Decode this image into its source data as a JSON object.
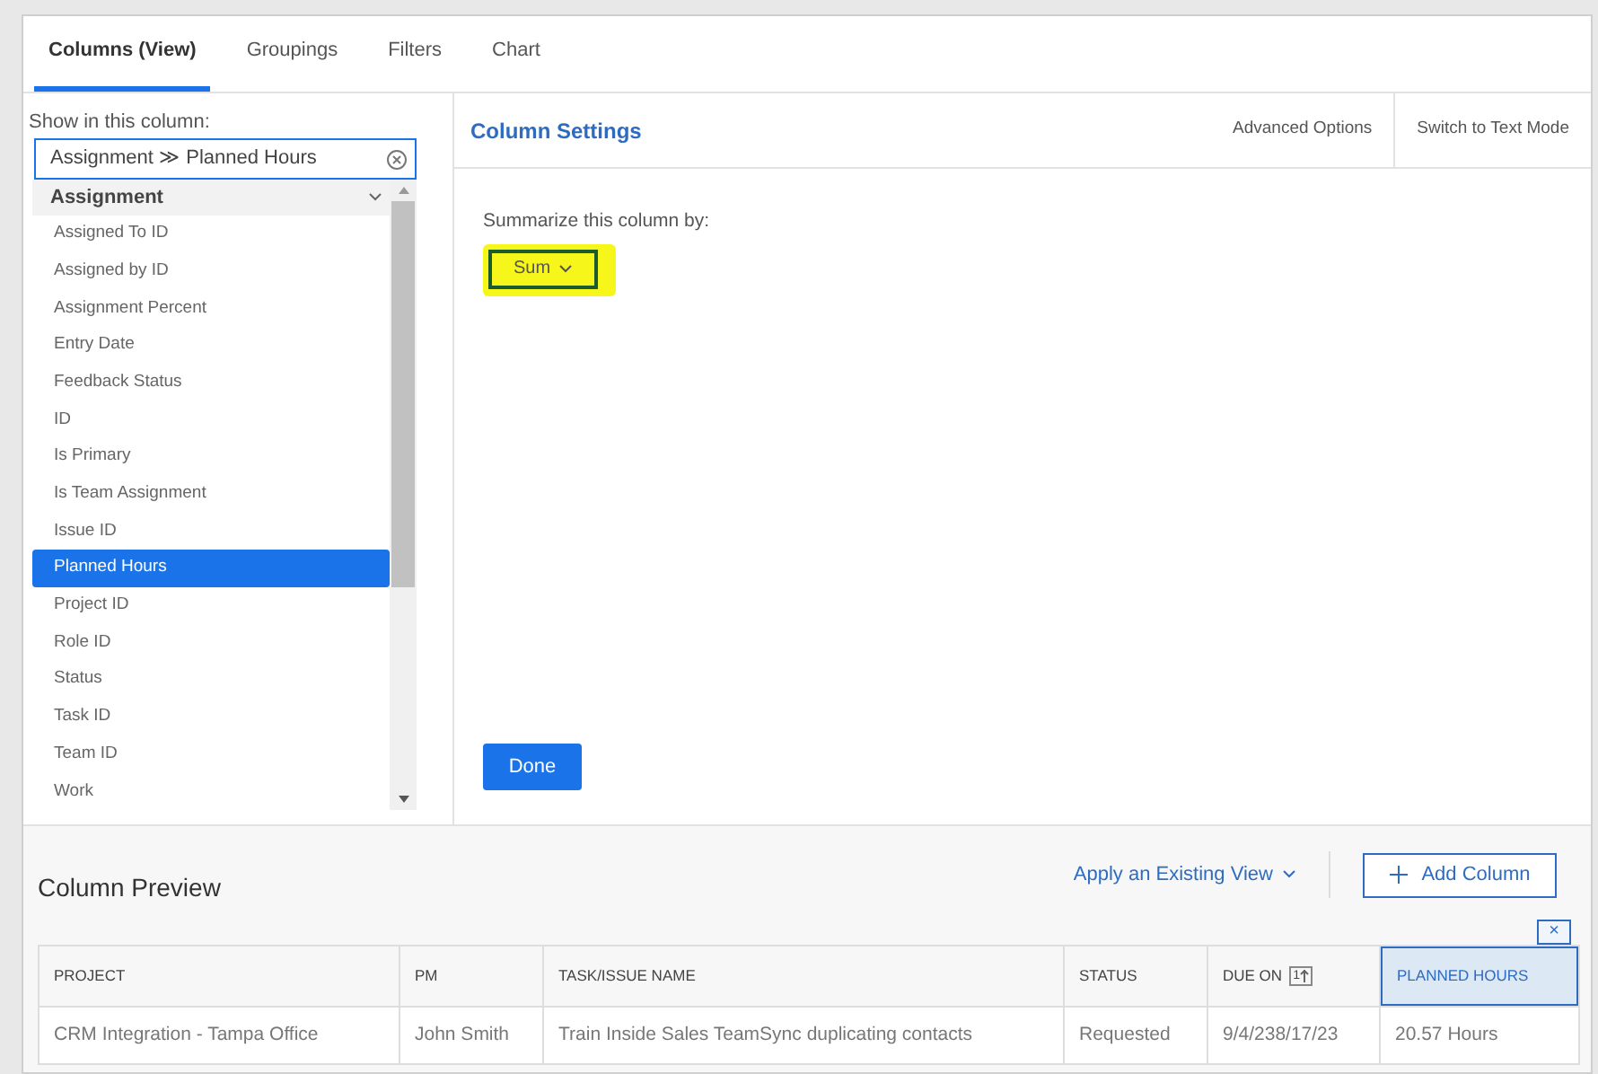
{
  "tabs": [
    {
      "label": "Columns (View)",
      "selected": true
    },
    {
      "label": "Groupings",
      "selected": false
    },
    {
      "label": "Filters",
      "selected": false
    },
    {
      "label": "Chart",
      "selected": false
    }
  ],
  "field_picker": {
    "label": "Show in this column:",
    "value_parts": [
      "Assignment",
      "Planned Hours"
    ],
    "separator": "≫",
    "group": "Assignment",
    "items": [
      {
        "label": "Assigned To ID",
        "selected": false
      },
      {
        "label": "Assigned by ID",
        "selected": false
      },
      {
        "label": "Assignment Percent",
        "selected": false
      },
      {
        "label": "Entry Date",
        "selected": false
      },
      {
        "label": "Feedback Status",
        "selected": false
      },
      {
        "label": "ID",
        "selected": false
      },
      {
        "label": "Is Primary",
        "selected": false
      },
      {
        "label": "Is Team Assignment",
        "selected": false
      },
      {
        "label": "Issue ID",
        "selected": false
      },
      {
        "label": "Planned Hours",
        "selected": true
      },
      {
        "label": "Project ID",
        "selected": false
      },
      {
        "label": "Role ID",
        "selected": false
      },
      {
        "label": "Status",
        "selected": false
      },
      {
        "label": "Task ID",
        "selected": false
      },
      {
        "label": "Team ID",
        "selected": false
      },
      {
        "label": "Work",
        "selected": false
      }
    ]
  },
  "settings": {
    "title": "Column Settings",
    "actions": [
      "Advanced Options",
      "Switch to Text Mode"
    ],
    "summarize_label": "Summarize this column by:",
    "summarize_value": "Sum",
    "done": "Done"
  },
  "preview": {
    "title": "Column Preview",
    "apply_view": "Apply an Existing View",
    "add_column": "Add Column",
    "remove": "×",
    "columns": [
      {
        "label": "PROJECT",
        "selected": false
      },
      {
        "label": "PM",
        "selected": false
      },
      {
        "label": "TASK/ISSUE NAME",
        "selected": false
      },
      {
        "label": "STATUS",
        "selected": false
      },
      {
        "label": "DUE ON",
        "selected": false,
        "sort": "1"
      },
      {
        "label": "PLANNED HOURS",
        "selected": true
      }
    ],
    "row": [
      "CRM Integration - Tampa Office",
      "John Smith",
      "Train Inside Sales TeamSync duplicating contacts",
      "Requested",
      "9/4/238/17/23",
      "20.57 Hours"
    ]
  }
}
